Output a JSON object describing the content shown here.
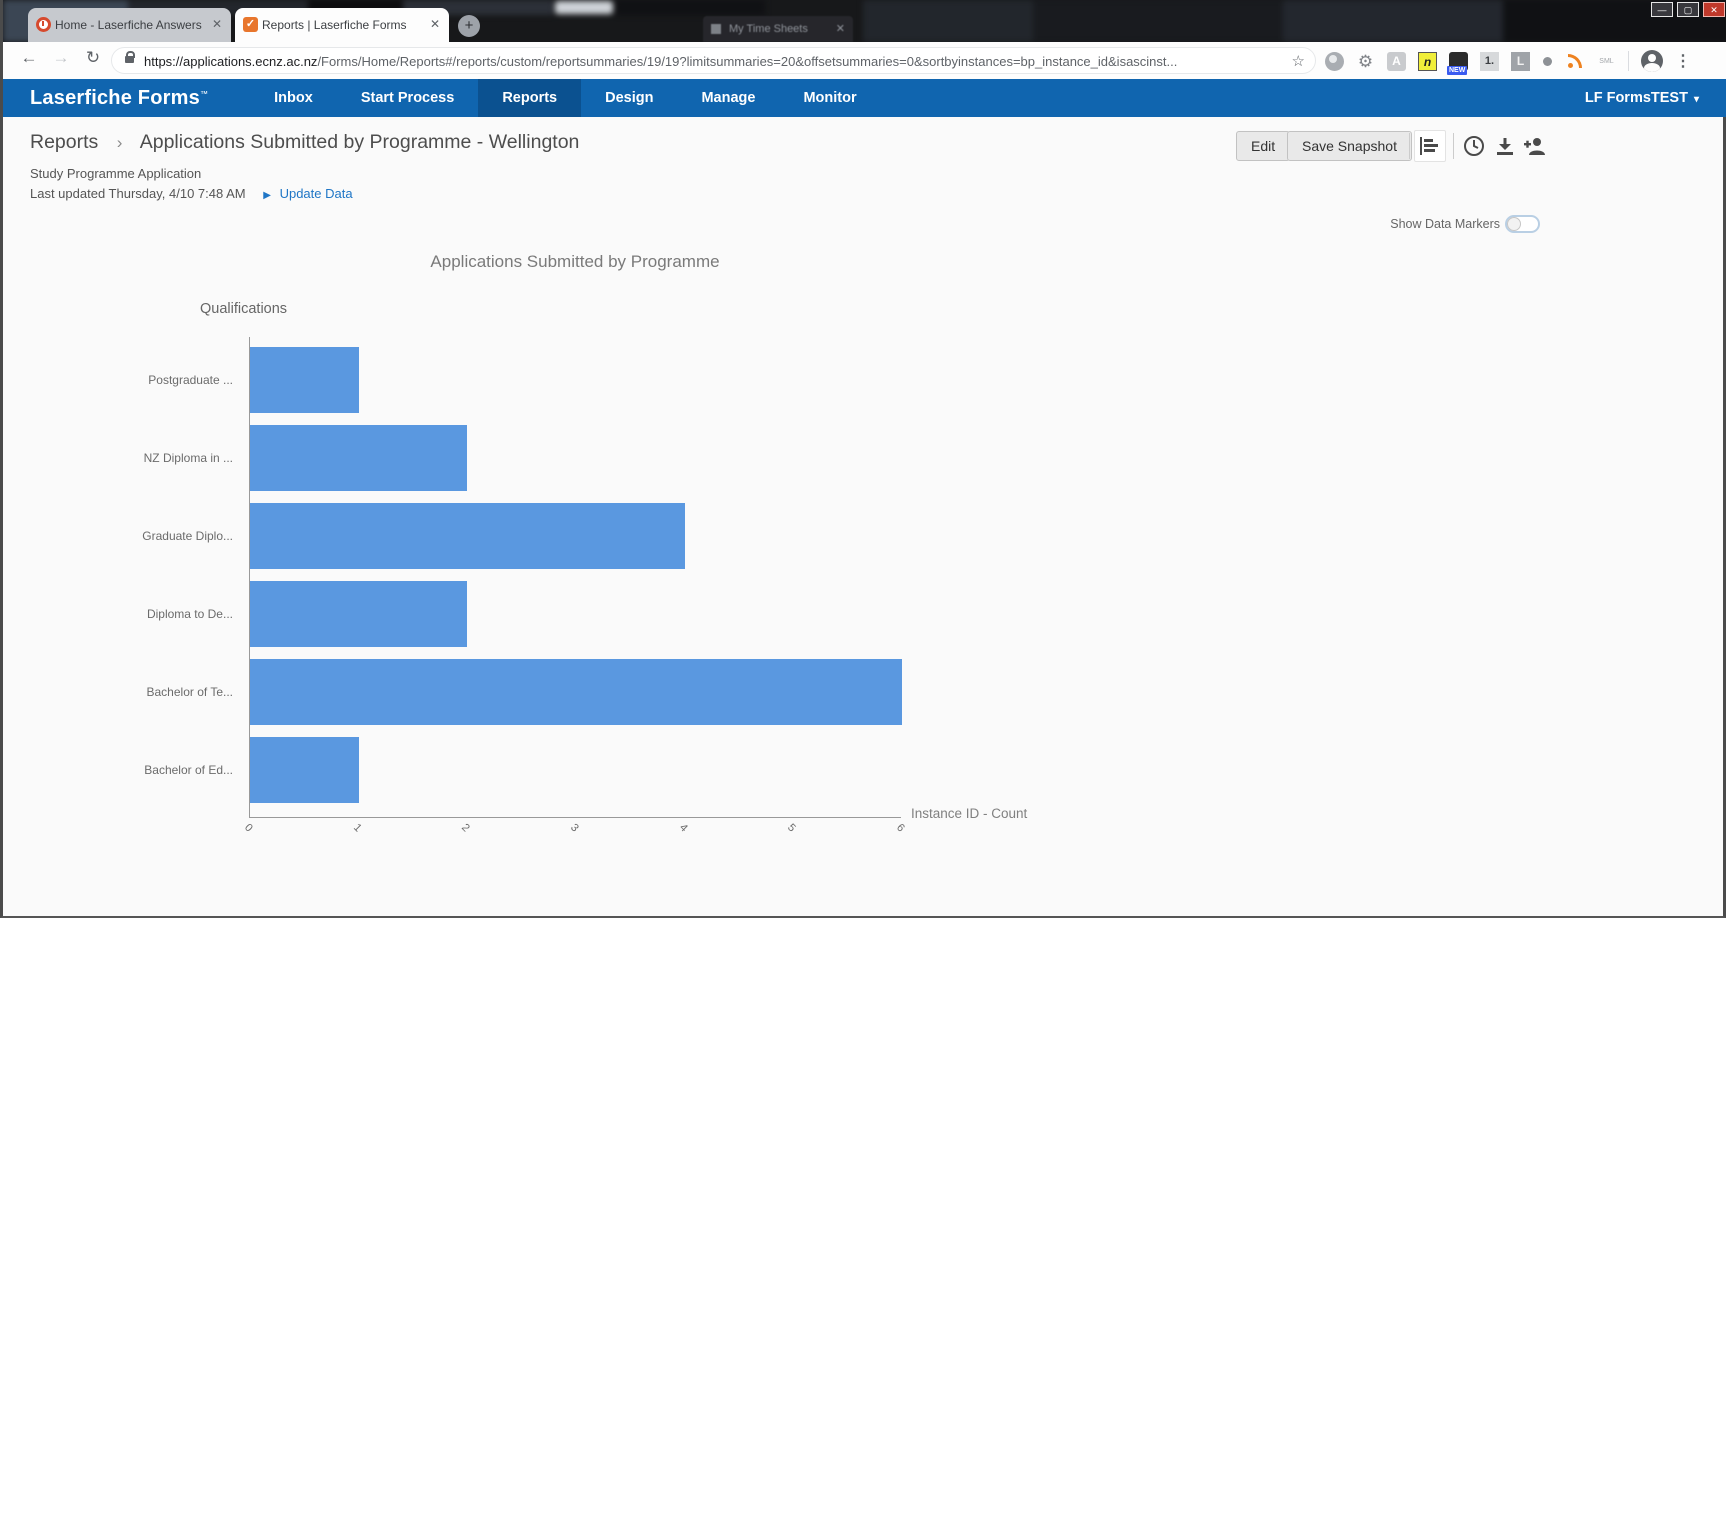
{
  "browser": {
    "background_window_title": "My Time Sheets",
    "tabs": [
      {
        "label": "Home - Laserfiche Answers"
      },
      {
        "label": "Reports | Laserfiche Forms"
      }
    ],
    "new_tab_glyph": "+",
    "tab_close_glyph": "✕",
    "window_controls": {
      "minimize": "—",
      "maximize": "▢",
      "close": "✕"
    },
    "nav_back_glyph": "←",
    "nav_forward_glyph": "→",
    "reload_glyph": "↻",
    "url": {
      "host": "https://applications.ecnz.ac.nz",
      "path": "/Forms/Home/Reports#/reports/custom/reportsummaries/19/19?limitsummaries=20&offsetsummaries=0&sortbyinstances=bp_instance_id&isascinst..."
    },
    "bookmark_star_glyph": "☆",
    "extensions": {
      "gear_glyph": "⚙",
      "acrobat_letter": "A",
      "onenote_letter": "n",
      "new_badge": "NEW",
      "onetab_label": "1.",
      "letter_l": "L",
      "sml_label": "SML"
    },
    "menu_kebab_glyph": "⋮"
  },
  "nav": {
    "brand": "Laserfiche Forms",
    "brand_tm": "™",
    "items": [
      {
        "label": "Inbox"
      },
      {
        "label": "Start Process"
      },
      {
        "label": "Reports"
      },
      {
        "label": "Design"
      },
      {
        "label": "Manage"
      },
      {
        "label": "Monitor"
      }
    ],
    "active_item": "Reports",
    "user": "LF FormsTEST",
    "user_caret": "▾"
  },
  "report": {
    "breadcrumb_root": "Reports",
    "breadcrumb_sep": "›",
    "title": "Applications Submitted by Programme - Wellington",
    "subtitle": "Study Programme Application",
    "last_updated": "Last updated Thursday, 4/10 7:48 AM",
    "update_data_glyph": "▶",
    "update_data_label": "Update Data",
    "edit_label": "Edit",
    "save_snapshot_label": "Save Snapshot",
    "show_data_markers_label": "Show Data Markers",
    "show_data_markers_on": false
  },
  "chart_data": {
    "type": "bar",
    "orientation": "horizontal",
    "title": "Applications Submitted by Programme",
    "ylabel": "Qualifications",
    "xlabel": "Instance ID - Count",
    "categories": [
      "Postgraduate ...",
      "NZ Diploma in ...",
      "Graduate Diplo...",
      "Diploma to De...",
      "Bachelor of Te...",
      "Bachelor of Ed..."
    ],
    "values": [
      1,
      2,
      4,
      2,
      6,
      1
    ],
    "xlim": [
      0,
      6
    ],
    "xticks": [
      0,
      1,
      2,
      3,
      4,
      5,
      6
    ],
    "bar_color": "#5A98E0",
    "grid": false,
    "legend": "none",
    "tick_rotation_deg": 45
  },
  "colors": {
    "nav_blue": "#1065AF",
    "nav_active_blue": "#0B5190",
    "link_blue": "#1F76C6",
    "bar_blue": "#5A98E0"
  }
}
